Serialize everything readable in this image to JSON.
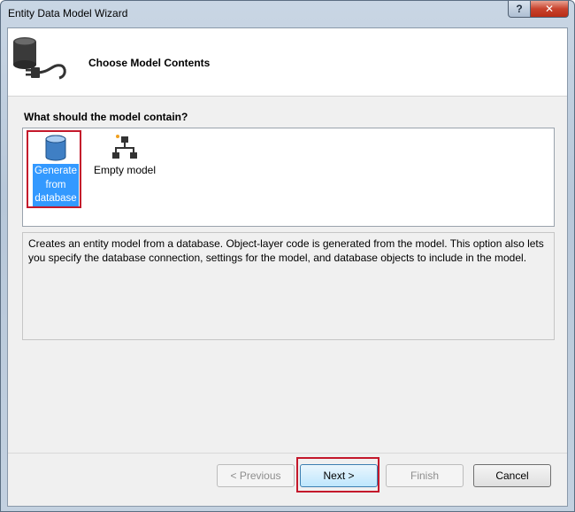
{
  "window": {
    "title": "Entity Data Model Wizard",
    "help_label": "?",
    "close_label": "✕"
  },
  "header": {
    "title": "Choose Model Contents",
    "icon": "database-plug-icon"
  },
  "question": "What should the model contain?",
  "options": [
    {
      "label": "Generate from database",
      "icon": "database-icon",
      "selected": true
    },
    {
      "label": "Empty model",
      "icon": "hierarchy-icon",
      "selected": false
    }
  ],
  "description": "Creates an entity model from a database. Object-layer code is generated from the model. This option also lets you specify the database connection, settings for the model, and database objects to include in the model.",
  "buttons": {
    "previous": "< Previous",
    "next": "Next >",
    "finish": "Finish",
    "cancel": "Cancel"
  },
  "colors": {
    "selection": "#3399ff",
    "highlight_box": "#c4182b"
  }
}
